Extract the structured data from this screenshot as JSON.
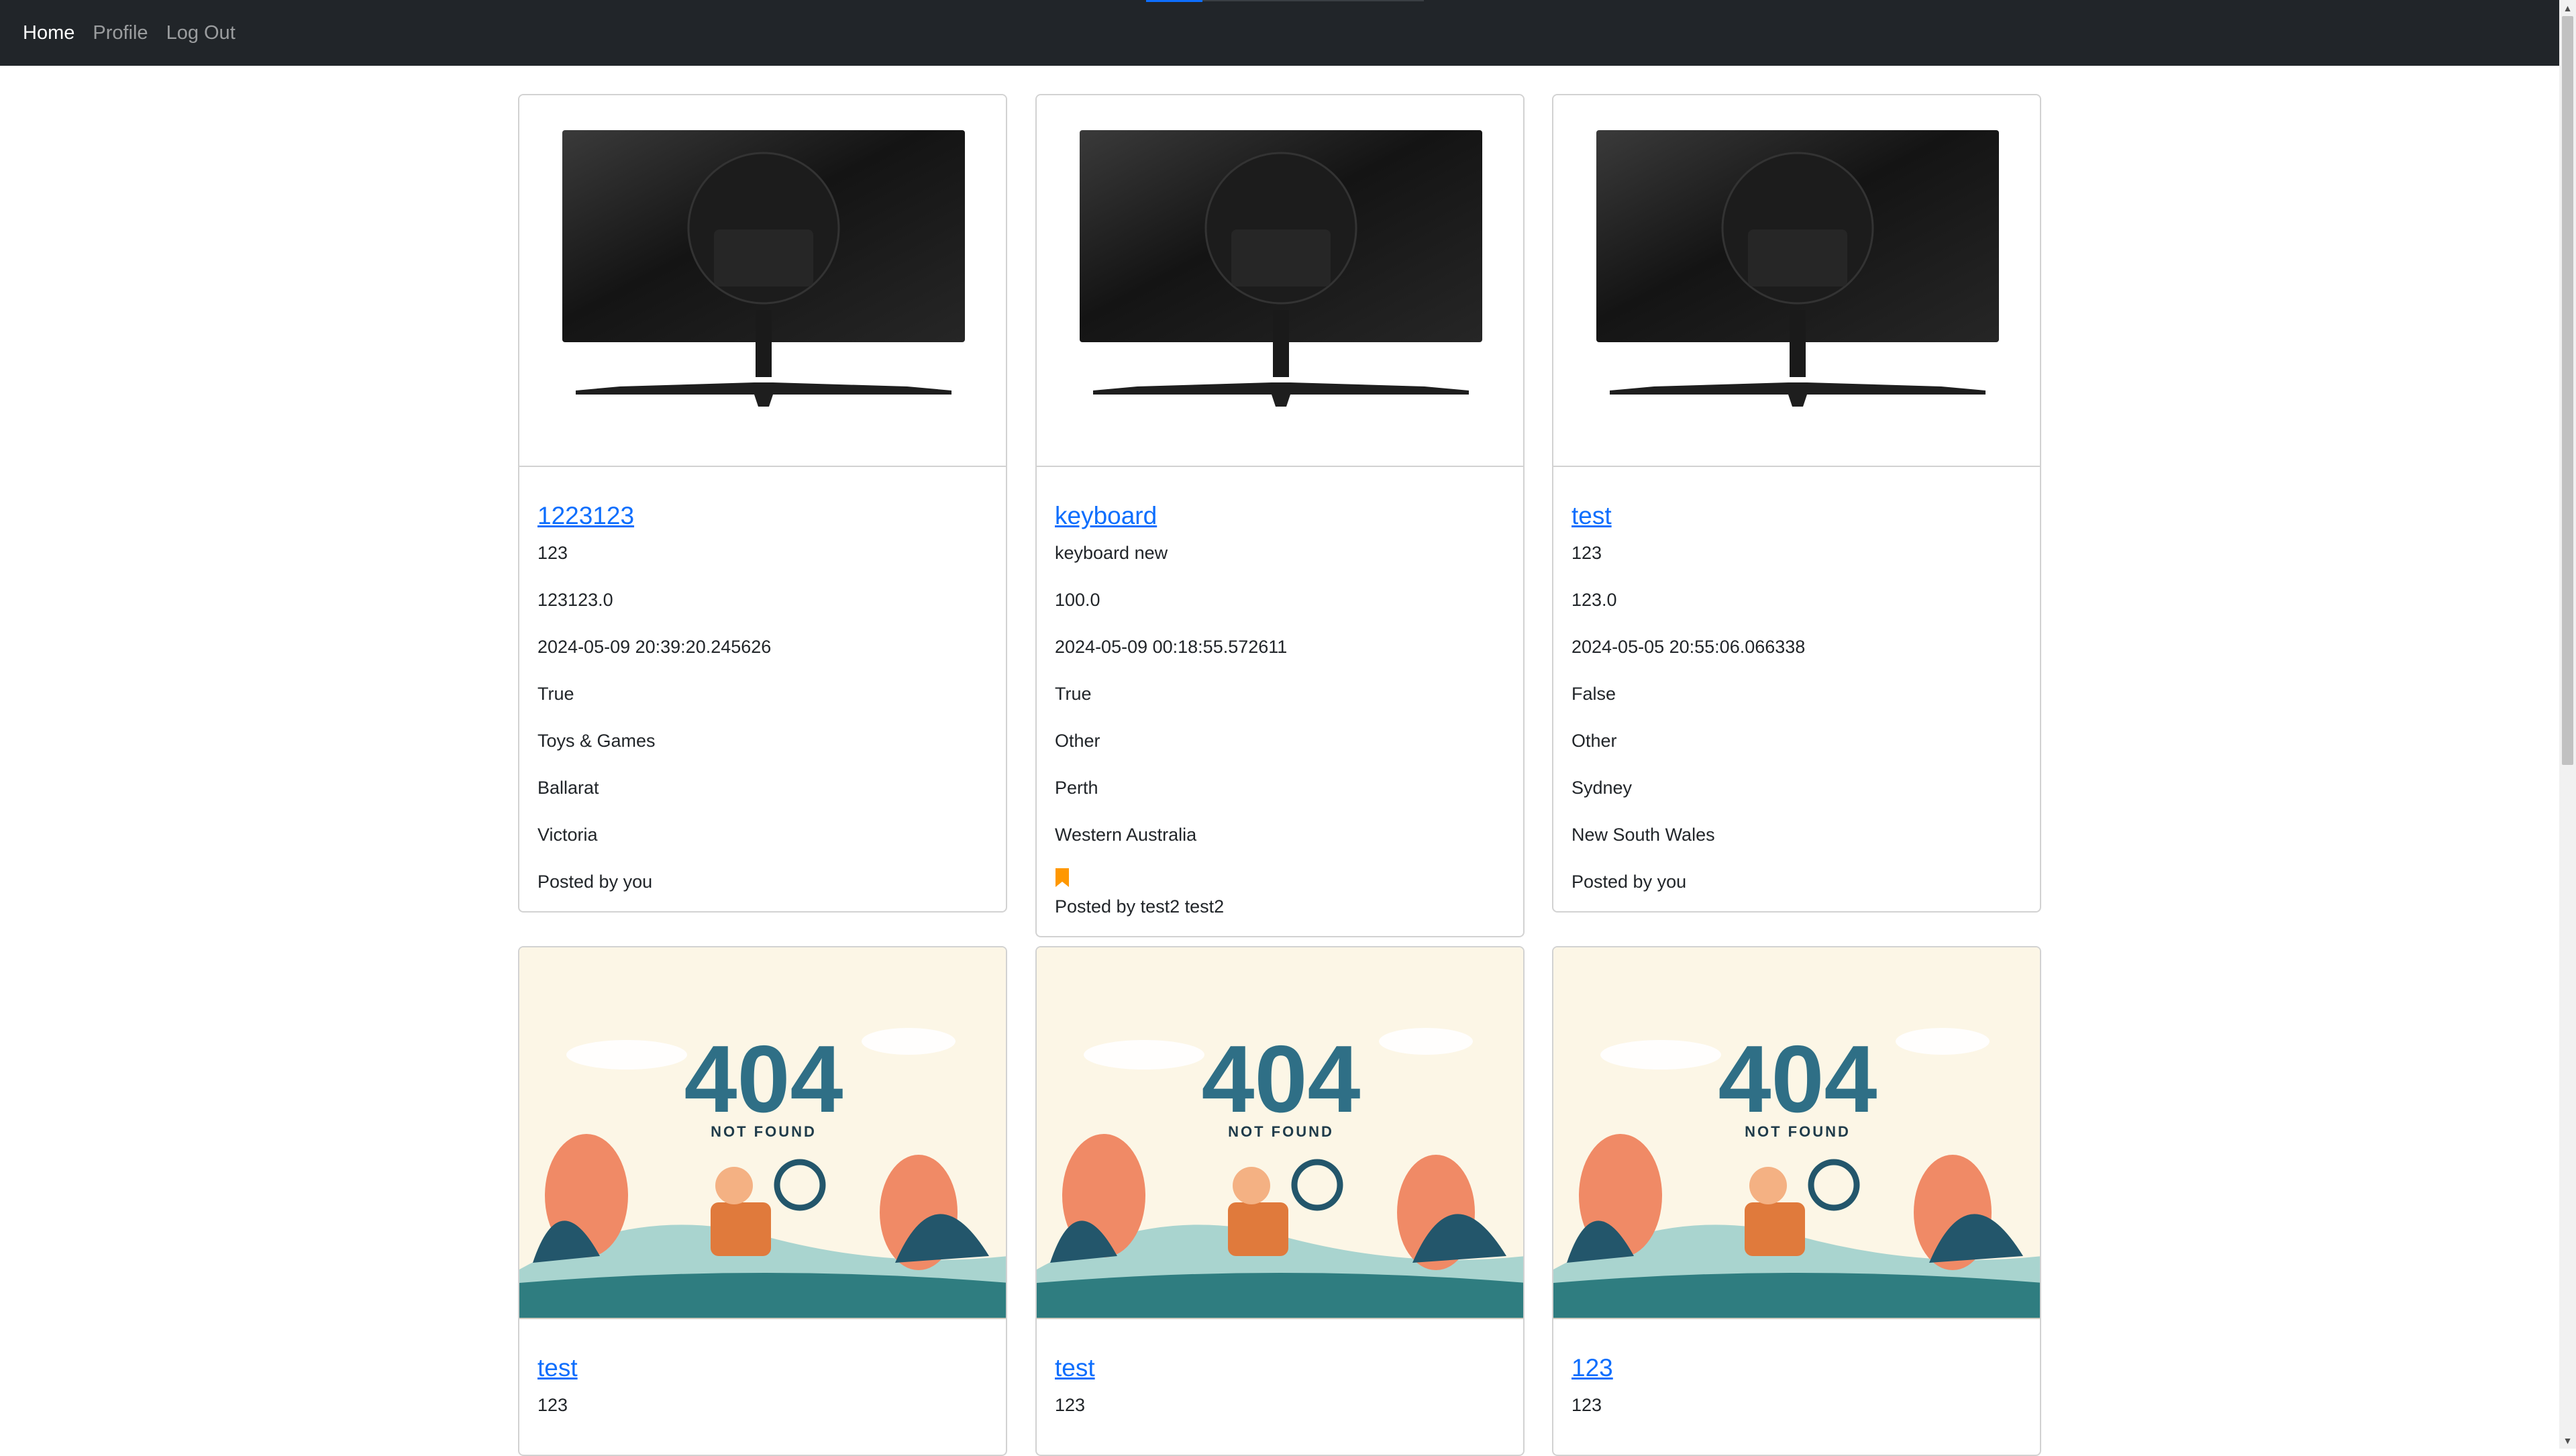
{
  "nav": {
    "items": [
      {
        "label": "Home",
        "active": true
      },
      {
        "label": "Profile",
        "active": false
      },
      {
        "label": "Log Out",
        "active": false
      }
    ]
  },
  "listings": [
    {
      "title": "1223123",
      "description": "123",
      "price": "123123.0",
      "date": "2024-05-09 20:39:20.245626",
      "flag": "True",
      "category": "Toys & Games",
      "city": "Ballarat",
      "state": "Victoria",
      "posted_by": "Posted by you",
      "image": "monitor",
      "bookmarked": false
    },
    {
      "title": "keyboard",
      "description": "keyboard new",
      "price": "100.0",
      "date": "2024-05-09 00:18:55.572611",
      "flag": "True",
      "category": "Other",
      "city": "Perth",
      "state": "Western Australia",
      "posted_by": "Posted by test2 test2",
      "image": "monitor",
      "bookmarked": true
    },
    {
      "title": "test",
      "description": "123",
      "price": "123.0",
      "date": "2024-05-05 20:55:06.066338",
      "flag": "False",
      "category": "Other",
      "city": "Sydney",
      "state": "New South Wales",
      "posted_by": "Posted by you",
      "image": "monitor",
      "bookmarked": false
    },
    {
      "title": "test",
      "description": "123",
      "image": "404 not found"
    },
    {
      "title": "test",
      "description": "123",
      "image": "404 not found"
    },
    {
      "title": "123",
      "description": "123",
      "image": "404 not found"
    }
  ],
  "placeholder_image": {
    "code": "404",
    "caption": "NOT FOUND"
  },
  "colors": {
    "navbar": "#212529",
    "link": "#0d6efd",
    "bookmark": "#ff9800",
    "placeholder_bg": "#fcf6e6"
  }
}
